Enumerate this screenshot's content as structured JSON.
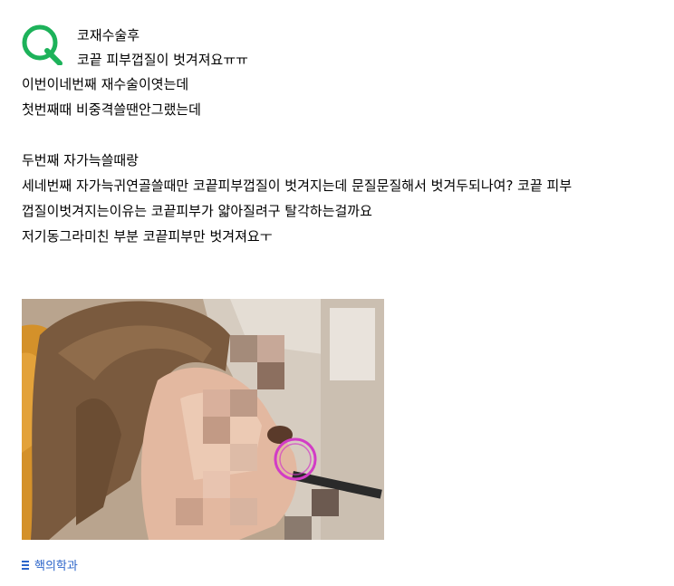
{
  "question": {
    "icon": "q-icon",
    "accent_color": "#1db25a",
    "title": "코재수술후",
    "subtitle": "코끝 피부껍질이 벗겨져요ㅠㅠ"
  },
  "body_lines": [
    "이번이네번째 재수술이엿는데",
    "첫번째때 비중격쓸땐안그랬는데",
    "",
    "두번째 자가늑쓸때랑",
    "세네번째 자가늑귀연골쓸때만 코끝피부껍질이 벗겨지는데 문질문질해서 벗겨두되나여? 코끝 피부",
    "껍질이벗겨지는이유는 코끝피부가 얇아질려구 탈각하는걸까요",
    "저기동그라미친 부분 코끝피부만 벗겨져요ㅜ"
  ],
  "category": {
    "icon": "list-icon",
    "label": "핵의학과",
    "color": "#2b64c9"
  }
}
